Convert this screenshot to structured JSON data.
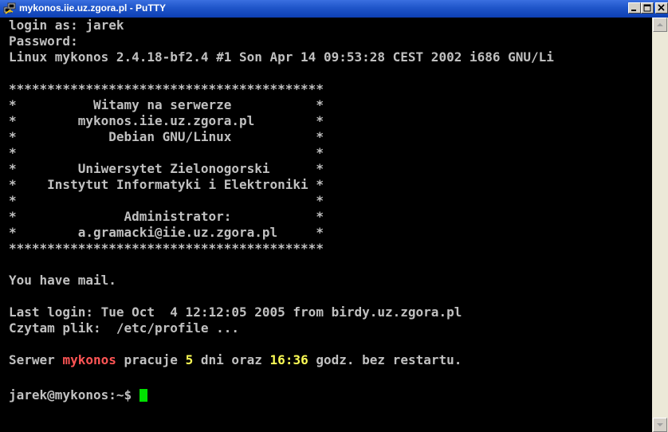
{
  "window": {
    "title": "mykonos.iie.uz.zgora.pl - PuTTY"
  },
  "colors": {
    "background": "#000000",
    "text": "#c0c0c0",
    "highlight_red": "#ff5555",
    "highlight_yellow": "#ffff55",
    "cursor": "#00e000",
    "titlebar": "#0d3fb4"
  },
  "icons": {
    "app": "putty-icon",
    "minimize": "minimize-icon",
    "maximize": "maximize-icon",
    "close": "close-icon",
    "scroll_up": "arrow-up-icon",
    "scroll_down": "arrow-down-icon"
  },
  "terminal": {
    "lines": [
      "login as: jarek",
      "Password:",
      "Linux mykonos 2.4.18-bf2.4 #1 Son Apr 14 09:53:28 CEST 2002 i686 GNU/Li",
      "",
      "*****************************************",
      "*          Witamy na serwerze           *",
      "*        mykonos.iie.uz.zgora.pl        *",
      "*            Debian GNU/Linux           *",
      "*                                       *",
      "*        Uniwersytet Zielonogorski      *",
      "*    Instytut Informatyki i Elektroniki *",
      "*                                       *",
      "*              Administrator:           *",
      "*        a.gramacki@iie.uz.zgora.pl     *",
      "*****************************************",
      "",
      "You have mail.",
      "",
      "Last login: Tue Oct  4 12:12:05 2005 from birdy.uz.zgora.pl",
      "Czytam plik:  /etc/profile ...",
      ""
    ],
    "status_line": {
      "p1": "Serwer ",
      "host": "mykonos",
      "p2": " pracuje ",
      "days": "5",
      "p3": " dni oraz ",
      "time": "16:36",
      "p4": " godz. bez restartu."
    },
    "empty_line": "",
    "prompt": "jarek@mykonos:~$ "
  }
}
